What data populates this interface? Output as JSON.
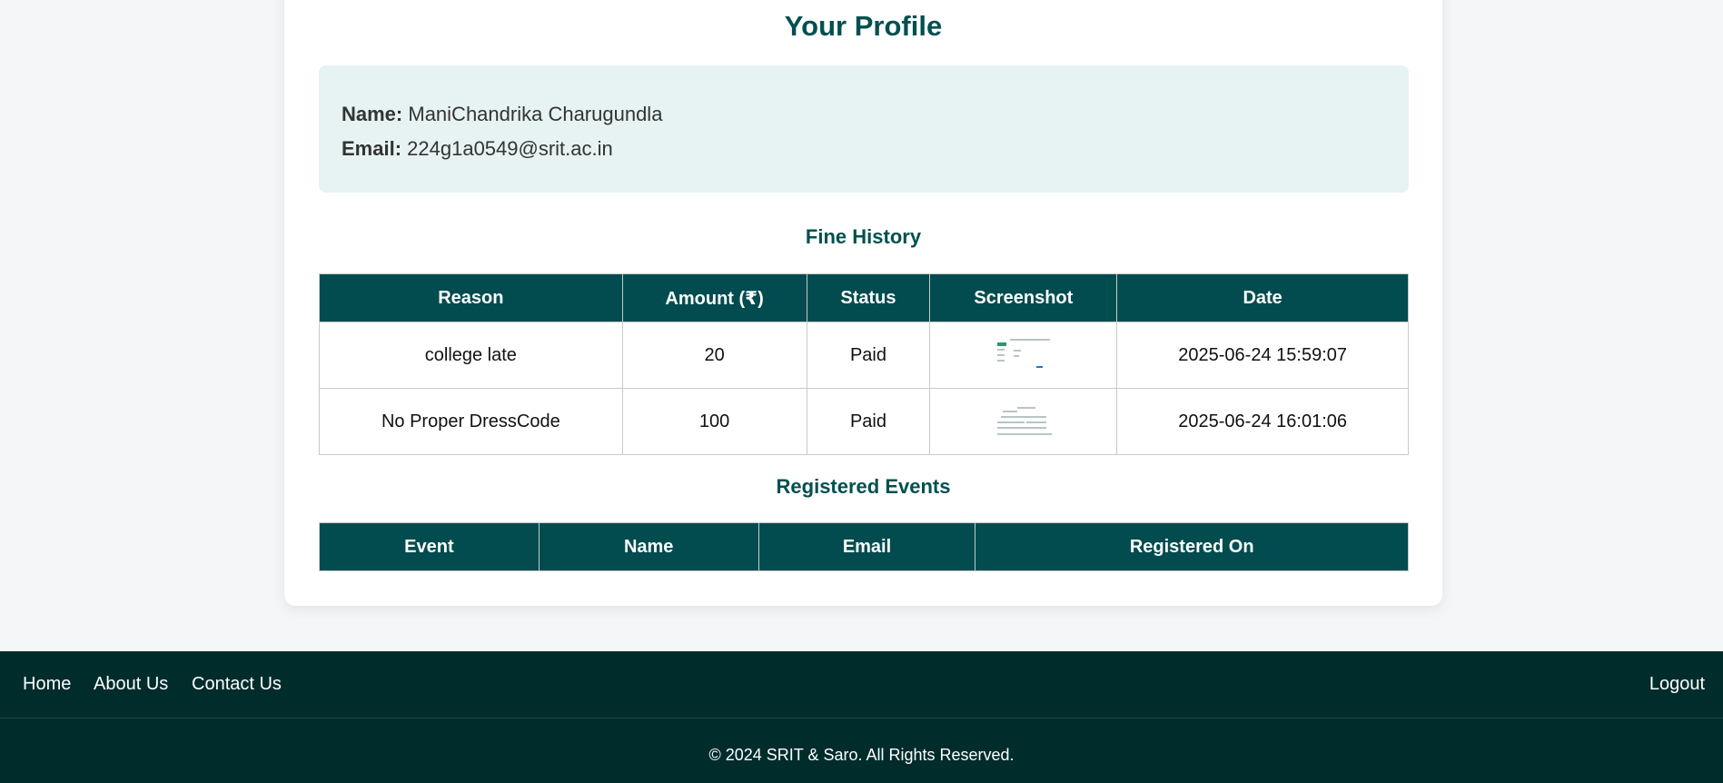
{
  "profile": {
    "title": "Your Profile",
    "name_label": "Name:",
    "name": "ManiChandrika Charugundla",
    "email_label": "Email:",
    "email": "224g1a0549@srit.ac.in"
  },
  "fines": {
    "title": "Fine History",
    "headers": [
      "Reason",
      "Amount (₹)",
      "Status",
      "Screenshot",
      "Date"
    ],
    "rows": [
      {
        "reason": "college late",
        "amount": "20",
        "status": "Paid",
        "date": "2025-06-24 15:59:07"
      },
      {
        "reason": "No Proper DressCode",
        "amount": "100",
        "status": "Paid",
        "date": "2025-06-24 16:01:06"
      }
    ]
  },
  "events": {
    "title": "Registered Events",
    "headers": [
      "Event",
      "Name",
      "Email",
      "Registered On"
    ]
  },
  "footer": {
    "nav": [
      "Home",
      "About Us",
      "Contact Us"
    ],
    "logout": "Logout",
    "copyright": "© 2024 SRIT & Saro. All Rights Reserved."
  },
  "colors": {
    "primary": "#024c4f",
    "footer_bg": "#012c2c",
    "profile_bg": "#e6f3f2"
  }
}
